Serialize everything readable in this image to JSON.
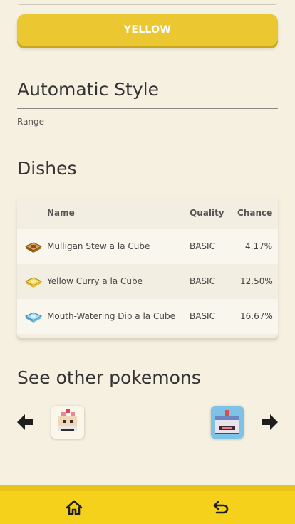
{
  "color_button": {
    "label": "YELLOW"
  },
  "automatic_style": {
    "title": "Automatic Style",
    "range_label": "Range"
  },
  "dishes": {
    "title": "Dishes",
    "columns": {
      "name": "Name",
      "quality": "Quality",
      "chance": "Chance"
    },
    "rows": [
      {
        "icon": "red-cube-dish-icon",
        "name": "Mulligan Stew a la Cube",
        "quality": "BASIC",
        "chance": "4.17%"
      },
      {
        "icon": "yellow-cube-dish-icon",
        "name": "Yellow Curry a la Cube",
        "quality": "BASIC",
        "chance": "12.50%"
      },
      {
        "icon": "blue-cube-dish-icon",
        "name": "Mouth-Watering Dip a la Cube",
        "quality": "BASIC",
        "chance": "16.67%"
      }
    ]
  },
  "other_pokemons": {
    "title": "See other pokemons",
    "prev": "arrow-left-icon",
    "next": "arrow-right-icon",
    "previous_pokemon": "pixel-pokemon-thumbnail",
    "next_pokemon": "pixel-pokemon-thumbnail"
  },
  "bottom_nav": {
    "home": "home-icon",
    "back": "back-arrow-icon"
  },
  "colors": {
    "accent_yellow": "#ebc832",
    "bottom_bar": "#f5d11c",
    "background": "#f6f0e1"
  }
}
